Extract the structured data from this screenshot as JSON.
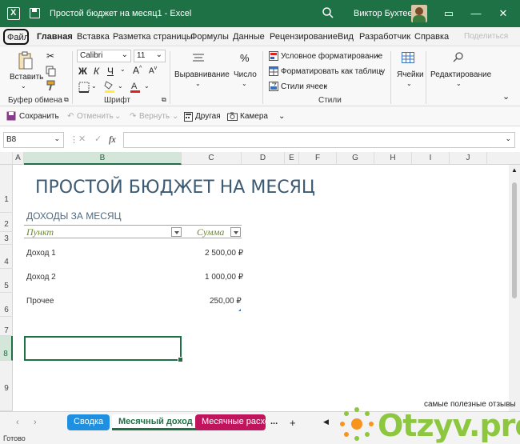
{
  "window": {
    "title": "Простой бюджет на месяц1  -  Excel",
    "user_name": "Виктор Бухтеев",
    "accent_color": "#1e7145"
  },
  "menu": {
    "file": "Файл",
    "items": [
      "Главная",
      "Вставка",
      "Разметка страницы",
      "Формулы",
      "Данные",
      "Рецензирование",
      "Вид",
      "Разработчик",
      "Справка",
      "Поделиться"
    ]
  },
  "ribbon": {
    "paste": "Вставить",
    "clipboard_group": "Буфер обмена",
    "font_name": "Calibri",
    "font_size": "11",
    "font_group": "Шрифт",
    "alignment": "Выравнивание",
    "number": "Число",
    "cond_format": "Условное форматирование",
    "format_table": "Форматировать как таблицу",
    "cell_styles": "Стили ячеек",
    "styles_group": "Стили",
    "cells": "Ячейки",
    "editing": "Редактирование"
  },
  "qat": {
    "save": "Сохранить",
    "undo": "Отменить",
    "redo": "Вернуть",
    "other": "Другая",
    "camera": "Камера"
  },
  "formula": {
    "name_box": "B8",
    "fx": "fx",
    "content": ""
  },
  "columns": [
    "A",
    "B",
    "C",
    "D",
    "E",
    "F",
    "G",
    "H",
    "I",
    "J"
  ],
  "rows": [
    "1",
    "2",
    "3",
    "4",
    "5",
    "6",
    "7",
    "8",
    "9"
  ],
  "sheet": {
    "title": "ПРОСТОЙ БЮДЖЕТ НА МЕСЯЦ",
    "section": "ДОХОДЫ ЗА МЕСЯЦ",
    "col_item": "Пункт",
    "col_sum": "Сумма",
    "rows": [
      {
        "item": "Доход 1",
        "sum": "2 500,00 ₽"
      },
      {
        "item": "Доход 2",
        "sum": "1 000,00 ₽"
      },
      {
        "item": "Прочее",
        "sum": "250,00 ₽"
      }
    ]
  },
  "tabs": {
    "summary": "Сводка",
    "monthly_income": "Месячный доход",
    "monthly_expenses": "Месячные расхо",
    "more": "...",
    "add": "+"
  },
  "status": "Готово",
  "watermark": {
    "small": "самые полезные отзывы",
    "big": "Otzyv.pro"
  }
}
